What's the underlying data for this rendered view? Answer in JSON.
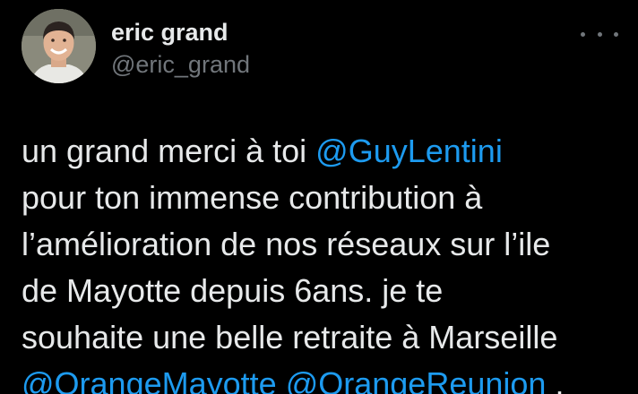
{
  "author": {
    "display_name": "eric grand",
    "handle": "@eric_grand"
  },
  "icons": {
    "more": "more-options-icon"
  },
  "colors": {
    "background": "#000000",
    "text": "#e7e9ea",
    "secondary": "#71767b",
    "link": "#1d9bf0"
  },
  "tweet": {
    "line1_text": "un grand merci à toi ",
    "mention_guy": "@GuyLentini",
    "line2": "pour ton immense contribution à",
    "line3": "l’amélioration de nos réseaux sur l’ile",
    "line4": "de Mayotte depuis 6ans. je te",
    "line5": "souhaite une belle retraite à Marseille",
    "mention_orange_mayotte": "@OrangeMayotte",
    "mention_orange_reunion": "@OrangeReunion",
    "line6_trailing": " ."
  }
}
